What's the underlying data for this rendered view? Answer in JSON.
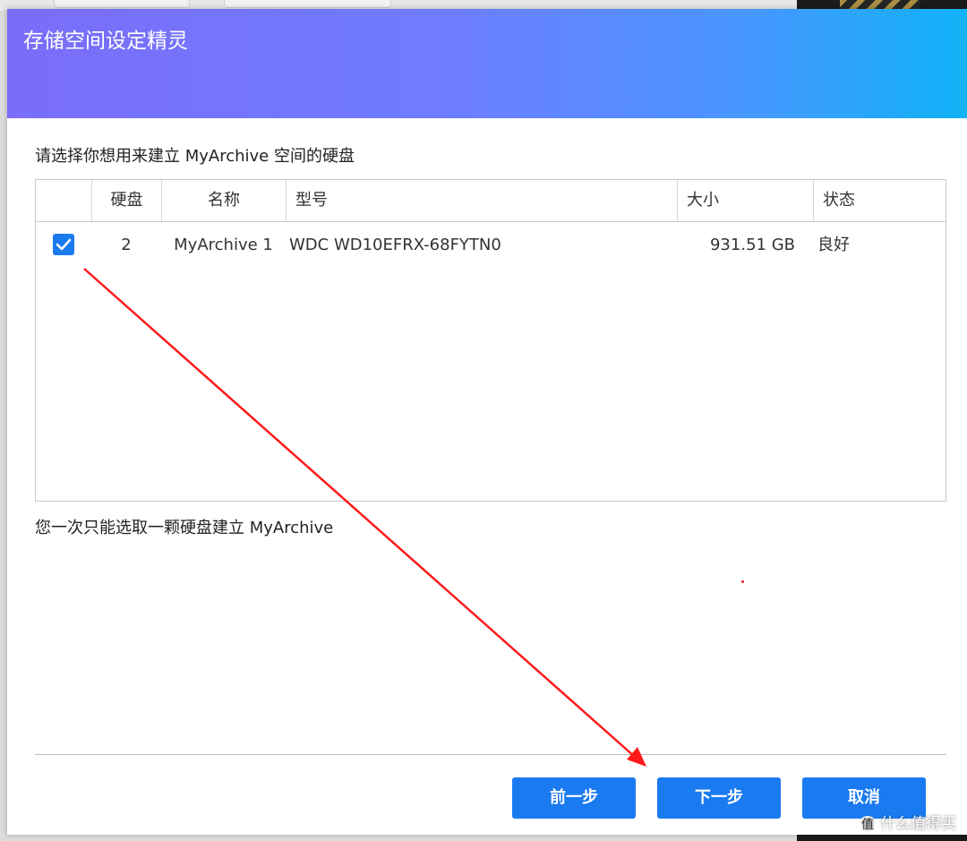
{
  "dialog": {
    "title": "存储空间设定精灵",
    "instruction": "请选择你想用来建立 MyArchive 空间的硬盘",
    "note": "您一次只能选取一颗硬盘建立 MyArchive"
  },
  "table": {
    "headers": [
      "硬盘",
      "名称",
      "型号",
      "大小",
      "状态"
    ],
    "rows": [
      {
        "checked": true,
        "disk": "2",
        "name": "MyArchive 1",
        "model": "WDC WD10EFRX-68FYTN0",
        "size": "931.51 GB",
        "status": "良好"
      }
    ]
  },
  "buttons": {
    "prev": "前一步",
    "next": "下一步",
    "cancel": "取消"
  },
  "watermark": {
    "badge": "值",
    "text": "什么值得买"
  },
  "colors": {
    "accent": "#1a7af0",
    "header_gradient_start": "#7a6df9",
    "header_gradient_end": "#11b3f7",
    "annotation_arrow": "#ff1a1a"
  }
}
